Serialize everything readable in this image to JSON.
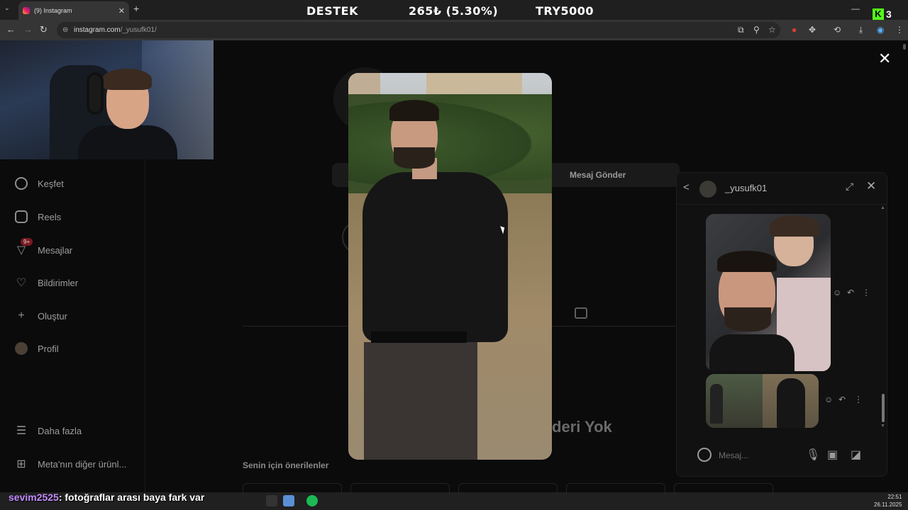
{
  "browser": {
    "tab_title": "(9) Instagram",
    "tab_close": "✕",
    "new_tab": "+",
    "tab_menu": "⌄",
    "url_host": "instagram.com",
    "url_path": "/_yusufk01/",
    "site_info_icon": "site-info-icon"
  },
  "stream_overlay": {
    "destek": "DESTEK",
    "amount": "265₺ (5.30%)",
    "goal": "TRY5000",
    "kick_logo": "K",
    "kick_count": "3"
  },
  "sidebar": {
    "items": [
      {
        "label": "Keşfet",
        "icon": "compass-icon"
      },
      {
        "label": "Reels",
        "icon": "reels-icon"
      },
      {
        "label": "Mesajlar",
        "icon": "messenger-icon"
      },
      {
        "label": "Bildirimler",
        "icon": "heart-icon"
      },
      {
        "label": "Oluştur",
        "icon": "plus-icon"
      },
      {
        "label": "Profil",
        "icon": "avatar"
      }
    ],
    "messages_badge": "9+",
    "more": "Daha fazla",
    "meta": "Meta'nın diğer ürünl..."
  },
  "profile_bg": {
    "send_message": "Mesaj Gönder",
    "no_posts": "deri Yok",
    "suggested": "Senin için önerilenler"
  },
  "dm": {
    "username": "_yusufk01",
    "message_placeholder": "Mesaj...",
    "back_icon": "chevron-left-icon",
    "expand_icon": "expand-icon",
    "close_icon": "close-icon"
  },
  "chat_overlay": {
    "user": "sevim2525",
    "text": ": fotoğraflar arası baya fark var"
  },
  "clock": {
    "time": "22:51",
    "date": "26.11.2025"
  },
  "colors": {
    "badge": "#7a1820",
    "kick_green": "#53fc18",
    "chat_user": "#c58cff"
  }
}
